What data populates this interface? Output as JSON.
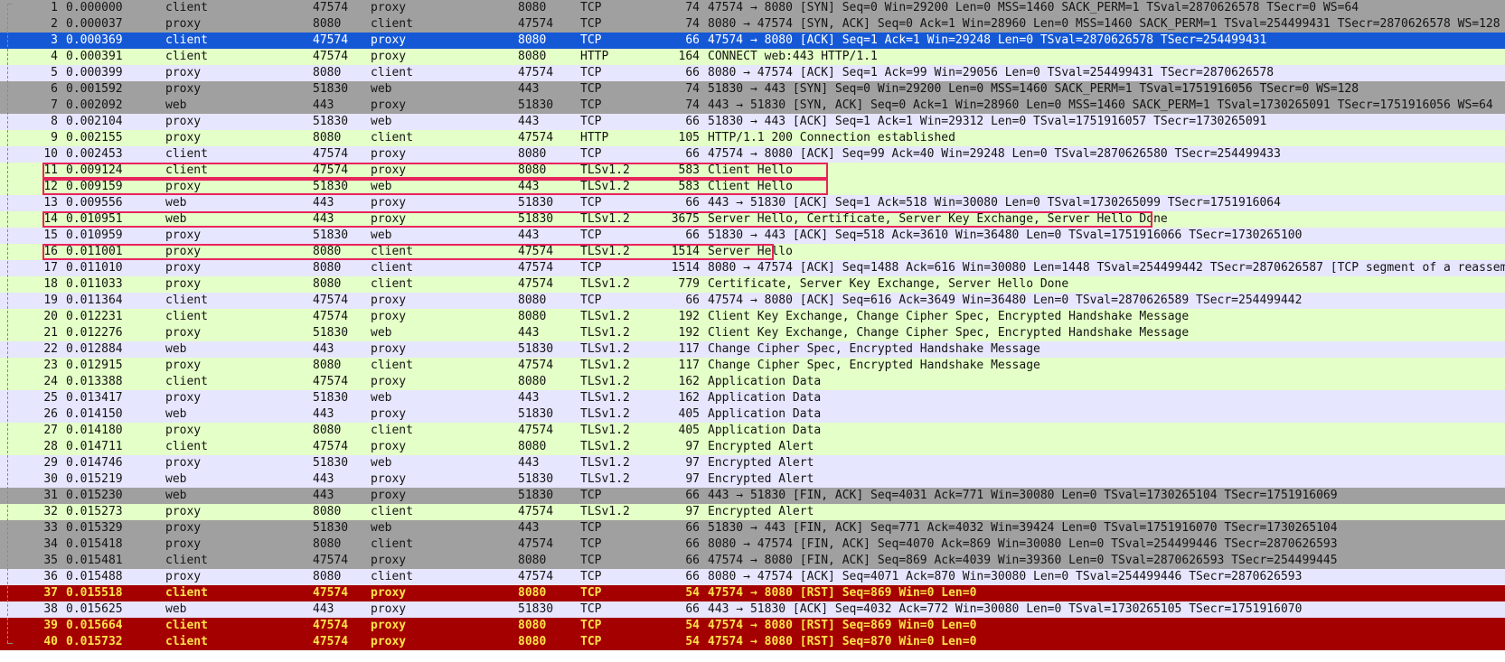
{
  "colors": {
    "tcp_grey": "#a0a0a0",
    "tcp_lavender": "#e7e6ff",
    "http_tls_green": "#e4ffc7",
    "selected_blue": "#1558d6",
    "rst_red": "#a50000",
    "rst_text": "#ffe14a",
    "highlight_box": "#e8245c"
  },
  "highlighted_rows": [
    11,
    12,
    14,
    16
  ],
  "packets": [
    {
      "no": "1",
      "time": "0.000000",
      "src": "client",
      "sport": "47574",
      "dst": "proxy",
      "dport": "8080",
      "proto": "TCP",
      "len": "74",
      "info": "47574 → 8080 [SYN] Seq=0 Win=29200 Len=0 MSS=1460 SACK_PERM=1 TSval=2870626578 TSecr=0 WS=64",
      "style": "grey"
    },
    {
      "no": "2",
      "time": "0.000037",
      "src": "proxy",
      "sport": "8080",
      "dst": "client",
      "dport": "47574",
      "proto": "TCP",
      "len": "74",
      "info": "8080 → 47574 [SYN, ACK] Seq=0 Ack=1 Win=28960 Len=0 MSS=1460 SACK_PERM=1 TSval=254499431 TSecr=2870626578 WS=128",
      "style": "grey"
    },
    {
      "no": "3",
      "time": "0.000369",
      "src": "client",
      "sport": "47574",
      "dst": "proxy",
      "dport": "8080",
      "proto": "TCP",
      "len": "66",
      "info": "47574 → 8080 [ACK] Seq=1 Ack=1 Win=29248 Len=0 TSval=2870626578 TSecr=254499431",
      "style": "selected"
    },
    {
      "no": "4",
      "time": "0.000391",
      "src": "client",
      "sport": "47574",
      "dst": "proxy",
      "dport": "8080",
      "proto": "HTTP",
      "len": "164",
      "info": "CONNECT web:443 HTTP/1.1",
      "style": "green"
    },
    {
      "no": "5",
      "time": "0.000399",
      "src": "proxy",
      "sport": "8080",
      "dst": "client",
      "dport": "47574",
      "proto": "TCP",
      "len": "66",
      "info": "8080 → 47574 [ACK] Seq=1 Ack=99 Win=29056 Len=0 TSval=254499431 TSecr=2870626578",
      "style": "lavender"
    },
    {
      "no": "6",
      "time": "0.001592",
      "src": "proxy",
      "sport": "51830",
      "dst": "web",
      "dport": "443",
      "proto": "TCP",
      "len": "74",
      "info": "51830 → 443 [SYN] Seq=0 Win=29200 Len=0 MSS=1460 SACK_PERM=1 TSval=1751916056 TSecr=0 WS=128",
      "style": "grey"
    },
    {
      "no": "7",
      "time": "0.002092",
      "src": "web",
      "sport": "443",
      "dst": "proxy",
      "dport": "51830",
      "proto": "TCP",
      "len": "74",
      "info": "443 → 51830 [SYN, ACK] Seq=0 Ack=1 Win=28960 Len=0 MSS=1460 SACK_PERM=1 TSval=1730265091 TSecr=1751916056 WS=64",
      "style": "grey"
    },
    {
      "no": "8",
      "time": "0.002104",
      "src": "proxy",
      "sport": "51830",
      "dst": "web",
      "dport": "443",
      "proto": "TCP",
      "len": "66",
      "info": "51830 → 443 [ACK] Seq=1 Ack=1 Win=29312 Len=0 TSval=1751916057 TSecr=1730265091",
      "style": "lavender"
    },
    {
      "no": "9",
      "time": "0.002155",
      "src": "proxy",
      "sport": "8080",
      "dst": "client",
      "dport": "47574",
      "proto": "HTTP",
      "len": "105",
      "info": "HTTP/1.1 200 Connection established",
      "style": "green"
    },
    {
      "no": "10",
      "time": "0.002453",
      "src": "client",
      "sport": "47574",
      "dst": "proxy",
      "dport": "8080",
      "proto": "TCP",
      "len": "66",
      "info": "47574 → 8080 [ACK] Seq=99 Ack=40 Win=29248 Len=0 TSval=2870626580 TSecr=254499433",
      "style": "lavender"
    },
    {
      "no": "11",
      "time": "0.009124",
      "src": "client",
      "sport": "47574",
      "dst": "proxy",
      "dport": "8080",
      "proto": "TLSv1.2",
      "len": "583",
      "info": "Client Hello",
      "style": "green"
    },
    {
      "no": "12",
      "time": "0.009159",
      "src": "proxy",
      "sport": "51830",
      "dst": "web",
      "dport": "443",
      "proto": "TLSv1.2",
      "len": "583",
      "info": "Client Hello",
      "style": "green"
    },
    {
      "no": "13",
      "time": "0.009556",
      "src": "web",
      "sport": "443",
      "dst": "proxy",
      "dport": "51830",
      "proto": "TCP",
      "len": "66",
      "info": "443 → 51830 [ACK] Seq=1 Ack=518 Win=30080 Len=0 TSval=1730265099 TSecr=1751916064",
      "style": "lavender"
    },
    {
      "no": "14",
      "time": "0.010951",
      "src": "web",
      "sport": "443",
      "dst": "proxy",
      "dport": "51830",
      "proto": "TLSv1.2",
      "len": "3675",
      "info": "Server Hello, Certificate, Server Key Exchange, Server Hello Done",
      "style": "green"
    },
    {
      "no": "15",
      "time": "0.010959",
      "src": "proxy",
      "sport": "51830",
      "dst": "web",
      "dport": "443",
      "proto": "TCP",
      "len": "66",
      "info": "51830 → 443 [ACK] Seq=518 Ack=3610 Win=36480 Len=0 TSval=1751916066 TSecr=1730265100",
      "style": "lavender"
    },
    {
      "no": "16",
      "time": "0.011001",
      "src": "proxy",
      "sport": "8080",
      "dst": "client",
      "dport": "47574",
      "proto": "TLSv1.2",
      "len": "1514",
      "info": "Server Hello",
      "style": "green"
    },
    {
      "no": "17",
      "time": "0.011010",
      "src": "proxy",
      "sport": "8080",
      "dst": "client",
      "dport": "47574",
      "proto": "TCP",
      "len": "1514",
      "info": "8080 → 47574 [ACK] Seq=1488 Ack=616 Win=30080 Len=1448 TSval=254499442 TSecr=2870626587 [TCP segment of a reassem",
      "style": "lavender"
    },
    {
      "no": "18",
      "time": "0.011033",
      "src": "proxy",
      "sport": "8080",
      "dst": "client",
      "dport": "47574",
      "proto": "TLSv1.2",
      "len": "779",
      "info": "Certificate, Server Key Exchange, Server Hello Done",
      "style": "green"
    },
    {
      "no": "19",
      "time": "0.011364",
      "src": "client",
      "sport": "47574",
      "dst": "proxy",
      "dport": "8080",
      "proto": "TCP",
      "len": "66",
      "info": "47574 → 8080 [ACK] Seq=616 Ack=3649 Win=36480 Len=0 TSval=2870626589 TSecr=254499442",
      "style": "lavender"
    },
    {
      "no": "20",
      "time": "0.012231",
      "src": "client",
      "sport": "47574",
      "dst": "proxy",
      "dport": "8080",
      "proto": "TLSv1.2",
      "len": "192",
      "info": "Client Key Exchange, Change Cipher Spec, Encrypted Handshake Message",
      "style": "green"
    },
    {
      "no": "21",
      "time": "0.012276",
      "src": "proxy",
      "sport": "51830",
      "dst": "web",
      "dport": "443",
      "proto": "TLSv1.2",
      "len": "192",
      "info": "Client Key Exchange, Change Cipher Spec, Encrypted Handshake Message",
      "style": "green"
    },
    {
      "no": "22",
      "time": "0.012884",
      "src": "web",
      "sport": "443",
      "dst": "proxy",
      "dport": "51830",
      "proto": "TLSv1.2",
      "len": "117",
      "info": "Change Cipher Spec, Encrypted Handshake Message",
      "style": "lavender"
    },
    {
      "no": "23",
      "time": "0.012915",
      "src": "proxy",
      "sport": "8080",
      "dst": "client",
      "dport": "47574",
      "proto": "TLSv1.2",
      "len": "117",
      "info": "Change Cipher Spec, Encrypted Handshake Message",
      "style": "green"
    },
    {
      "no": "24",
      "time": "0.013388",
      "src": "client",
      "sport": "47574",
      "dst": "proxy",
      "dport": "8080",
      "proto": "TLSv1.2",
      "len": "162",
      "info": "Application Data",
      "style": "green"
    },
    {
      "no": "25",
      "time": "0.013417",
      "src": "proxy",
      "sport": "51830",
      "dst": "web",
      "dport": "443",
      "proto": "TLSv1.2",
      "len": "162",
      "info": "Application Data",
      "style": "lavender"
    },
    {
      "no": "26",
      "time": "0.014150",
      "src": "web",
      "sport": "443",
      "dst": "proxy",
      "dport": "51830",
      "proto": "TLSv1.2",
      "len": "405",
      "info": "Application Data",
      "style": "lavender"
    },
    {
      "no": "27",
      "time": "0.014180",
      "src": "proxy",
      "sport": "8080",
      "dst": "client",
      "dport": "47574",
      "proto": "TLSv1.2",
      "len": "405",
      "info": "Application Data",
      "style": "green"
    },
    {
      "no": "28",
      "time": "0.014711",
      "src": "client",
      "sport": "47574",
      "dst": "proxy",
      "dport": "8080",
      "proto": "TLSv1.2",
      "len": "97",
      "info": "Encrypted Alert",
      "style": "green"
    },
    {
      "no": "29",
      "time": "0.014746",
      "src": "proxy",
      "sport": "51830",
      "dst": "web",
      "dport": "443",
      "proto": "TLSv1.2",
      "len": "97",
      "info": "Encrypted Alert",
      "style": "lavender"
    },
    {
      "no": "30",
      "time": "0.015219",
      "src": "web",
      "sport": "443",
      "dst": "proxy",
      "dport": "51830",
      "proto": "TLSv1.2",
      "len": "97",
      "info": "Encrypted Alert",
      "style": "lavender"
    },
    {
      "no": "31",
      "time": "0.015230",
      "src": "web",
      "sport": "443",
      "dst": "proxy",
      "dport": "51830",
      "proto": "TCP",
      "len": "66",
      "info": "443 → 51830 [FIN, ACK] Seq=4031 Ack=771 Win=30080 Len=0 TSval=1730265104 TSecr=1751916069",
      "style": "grey"
    },
    {
      "no": "32",
      "time": "0.015273",
      "src": "proxy",
      "sport": "8080",
      "dst": "client",
      "dport": "47574",
      "proto": "TLSv1.2",
      "len": "97",
      "info": "Encrypted Alert",
      "style": "green"
    },
    {
      "no": "33",
      "time": "0.015329",
      "src": "proxy",
      "sport": "51830",
      "dst": "web",
      "dport": "443",
      "proto": "TCP",
      "len": "66",
      "info": "51830 → 443 [FIN, ACK] Seq=771 Ack=4032 Win=39424 Len=0 TSval=1751916070 TSecr=1730265104",
      "style": "grey"
    },
    {
      "no": "34",
      "time": "0.015418",
      "src": "proxy",
      "sport": "8080",
      "dst": "client",
      "dport": "47574",
      "proto": "TCP",
      "len": "66",
      "info": "8080 → 47574 [FIN, ACK] Seq=4070 Ack=869 Win=30080 Len=0 TSval=254499446 TSecr=2870626593",
      "style": "grey"
    },
    {
      "no": "35",
      "time": "0.015481",
      "src": "client",
      "sport": "47574",
      "dst": "proxy",
      "dport": "8080",
      "proto": "TCP",
      "len": "66",
      "info": "47574 → 8080 [FIN, ACK] Seq=869 Ack=4039 Win=39360 Len=0 TSval=2870626593 TSecr=254499445",
      "style": "grey"
    },
    {
      "no": "36",
      "time": "0.015488",
      "src": "proxy",
      "sport": "8080",
      "dst": "client",
      "dport": "47574",
      "proto": "TCP",
      "len": "66",
      "info": "8080 → 47574 [ACK] Seq=4071 Ack=870 Win=30080 Len=0 TSval=254499446 TSecr=2870626593",
      "style": "lavender"
    },
    {
      "no": "37",
      "time": "0.015518",
      "src": "client",
      "sport": "47574",
      "dst": "proxy",
      "dport": "8080",
      "proto": "TCP",
      "len": "54",
      "info": "47574 → 8080 [RST] Seq=869 Win=0 Len=0",
      "style": "rst"
    },
    {
      "no": "38",
      "time": "0.015625",
      "src": "web",
      "sport": "443",
      "dst": "proxy",
      "dport": "51830",
      "proto": "TCP",
      "len": "66",
      "info": "443 → 51830 [ACK] Seq=4032 Ack=772 Win=30080 Len=0 TSval=1730265105 TSecr=1751916070",
      "style": "lavender"
    },
    {
      "no": "39",
      "time": "0.015664",
      "src": "client",
      "sport": "47574",
      "dst": "proxy",
      "dport": "8080",
      "proto": "TCP",
      "len": "54",
      "info": "47574 → 8080 [RST] Seq=869 Win=0 Len=0",
      "style": "rst"
    },
    {
      "no": "40",
      "time": "0.015732",
      "src": "client",
      "sport": "47574",
      "dst": "proxy",
      "dport": "8080",
      "proto": "TCP",
      "len": "54",
      "info": "47574 → 8080 [RST] Seq=870 Win=0 Len=0",
      "style": "rst"
    }
  ]
}
